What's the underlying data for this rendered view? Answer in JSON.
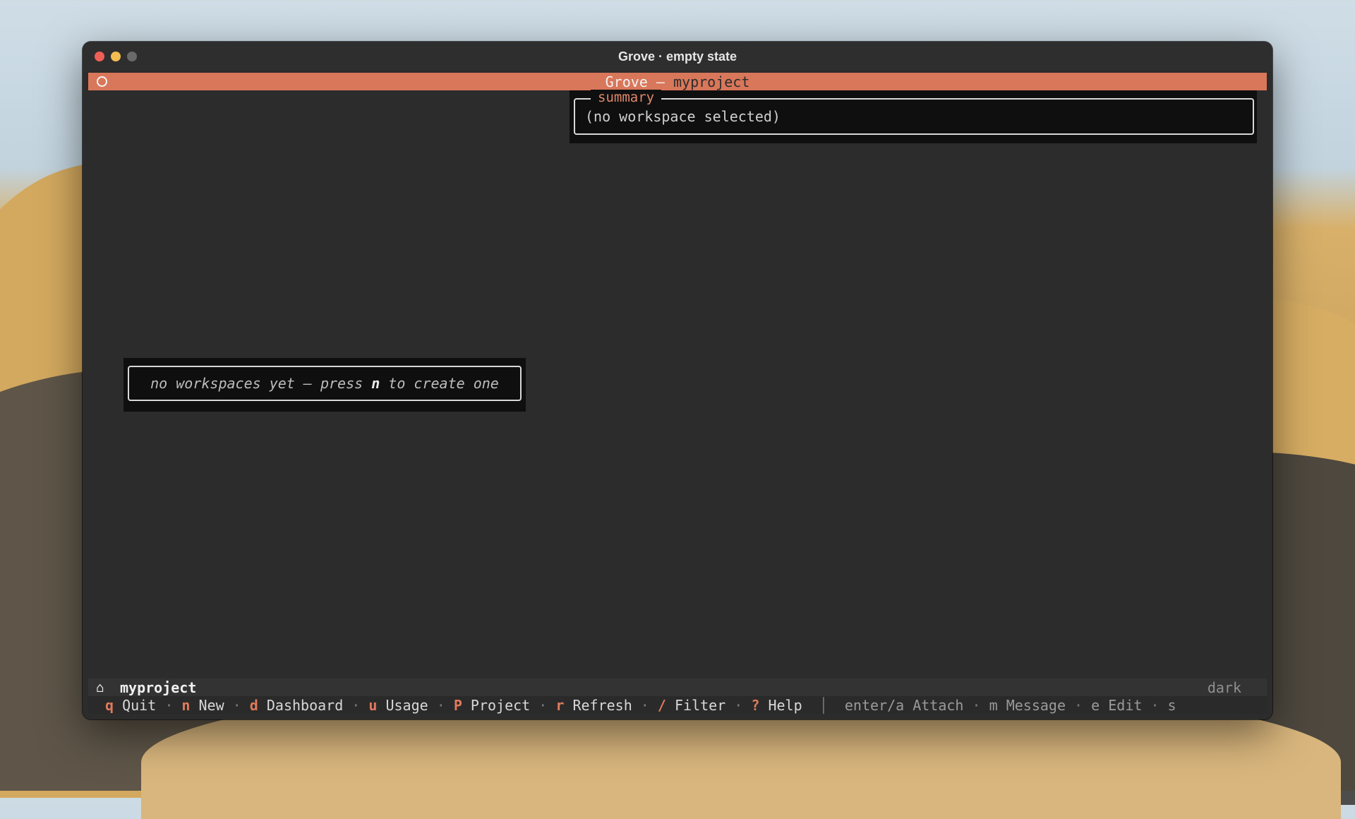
{
  "window": {
    "title": "Grove · empty state"
  },
  "header": {
    "app": "Grove",
    "dash": " — ",
    "project": "myproject"
  },
  "summary": {
    "label": "summary",
    "value": "(no workspace selected)"
  },
  "empty_state": {
    "prefix": "no workspaces yet — press ",
    "key": "n",
    "suffix": " to create one"
  },
  "status": {
    "project": "myproject",
    "theme": "dark",
    "shortcuts": [
      {
        "key": "q",
        "label": "Quit"
      },
      {
        "key": "n",
        "label": "New"
      },
      {
        "key": "d",
        "label": "Dashboard"
      },
      {
        "key": "u",
        "label": "Usage"
      },
      {
        "key": "P",
        "label": "Project"
      },
      {
        "key": "r",
        "label": "Refresh"
      },
      {
        "key": "/",
        "label": "Filter"
      },
      {
        "key": "?",
        "label": "Help"
      }
    ],
    "divider": "│",
    "context_shortcuts": [
      {
        "key": "enter/a",
        "label": "Attach"
      },
      {
        "key": "m",
        "label": "Message"
      },
      {
        "key": "e",
        "label": "Edit"
      },
      {
        "key": "s",
        "label": ""
      }
    ]
  },
  "icons": {
    "home": "home-icon",
    "status_dot": "circle-icon"
  },
  "colors": {
    "accent": "#d9775a",
    "key": "#e07a5c",
    "background": "#2c2c2c"
  }
}
